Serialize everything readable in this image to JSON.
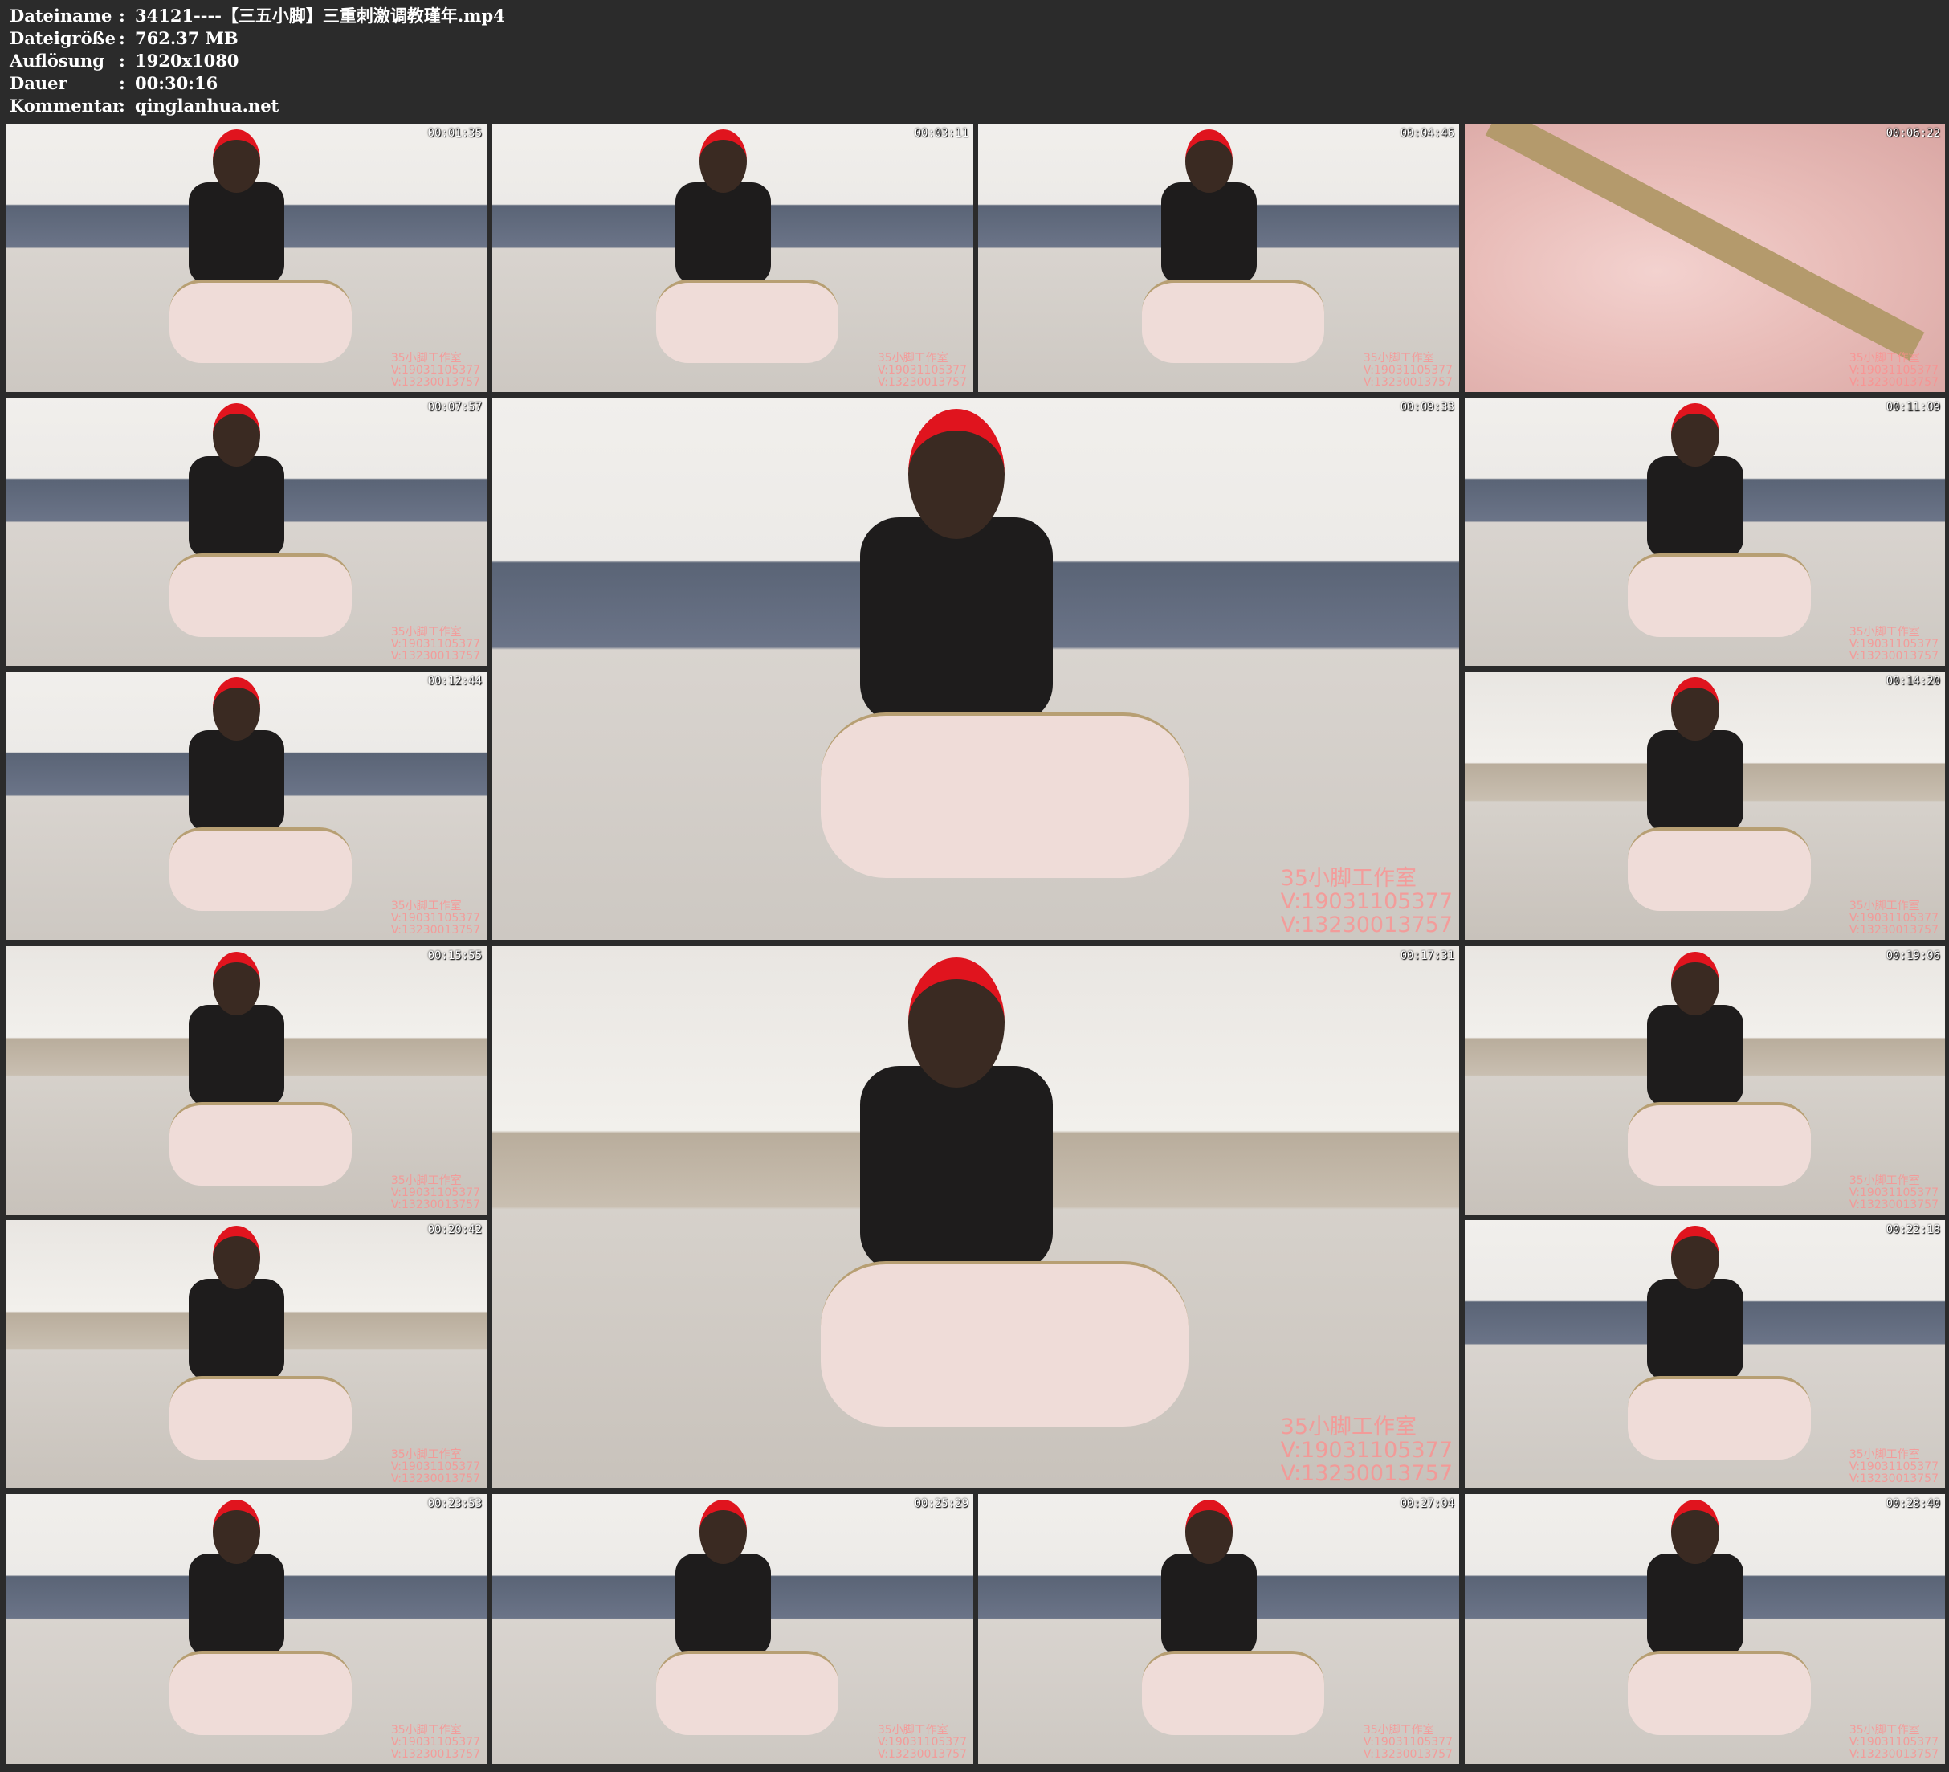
{
  "meta": {
    "rows": [
      {
        "label": "Dateiname",
        "value": "34121----【三五小脚】三重刺激调教瑾年.mp4"
      },
      {
        "label": "Dateigröße",
        "value": "762.37 MB"
      },
      {
        "label": "Auflösung",
        "value": "1920x1080"
      },
      {
        "label": "Dauer",
        "value": "00:30:16"
      },
      {
        "label": "Kommentar",
        "value": "qinglanhua.net"
      }
    ],
    "separator": ":"
  },
  "watermark": {
    "line1": "35小脚工作室",
    "line2": "V:19031105377",
    "line3": "V:13230013757"
  },
  "thumbnails": [
    {
      "timestamp": "00:01:35",
      "scene": "bedroom"
    },
    {
      "timestamp": "00:03:11",
      "scene": "bedroom"
    },
    {
      "timestamp": "00:04:46",
      "scene": "bedroom"
    },
    {
      "timestamp": "00:06:22",
      "scene": "closeup"
    },
    {
      "timestamp": "00:07:57",
      "scene": "bedroom"
    },
    {
      "timestamp": "00:09:33",
      "scene": "bedroom"
    },
    {
      "timestamp": "00:11:09",
      "scene": "bedroom"
    },
    {
      "timestamp": "00:12:44",
      "scene": "bedroom"
    },
    {
      "timestamp": "00:14:20",
      "scene": "livingroom"
    },
    {
      "timestamp": "00:15:55",
      "scene": "livingroom"
    },
    {
      "timestamp": "00:17:31",
      "scene": "livingroom"
    },
    {
      "timestamp": "00:19:06",
      "scene": "livingroom"
    },
    {
      "timestamp": "00:20:42",
      "scene": "livingroom"
    },
    {
      "timestamp": "00:22:18",
      "scene": "bedroom"
    },
    {
      "timestamp": "00:23:53",
      "scene": "bedroom"
    },
    {
      "timestamp": "00:25:29",
      "scene": "bedroom"
    },
    {
      "timestamp": "00:27:04",
      "scene": "bedroom"
    },
    {
      "timestamp": "00:28:40",
      "scene": "bedroom"
    }
  ]
}
